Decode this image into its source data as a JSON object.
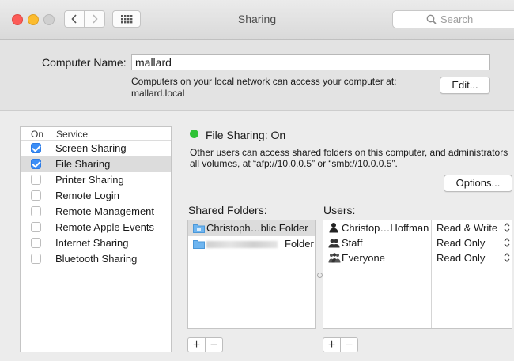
{
  "window": {
    "title": "Sharing",
    "search_placeholder": "Search"
  },
  "computer_name": {
    "label": "Computer Name:",
    "value": "mallard",
    "info_line1": "Computers on your local network can access your computer at:",
    "info_line2": "mallard.local",
    "edit_button": "Edit..."
  },
  "services": {
    "col_on": "On",
    "col_service": "Service",
    "items": [
      {
        "label": "Screen Sharing",
        "checked": true,
        "selected": false
      },
      {
        "label": "File Sharing",
        "checked": true,
        "selected": true
      },
      {
        "label": "Printer Sharing",
        "checked": false,
        "selected": false
      },
      {
        "label": "Remote Login",
        "checked": false,
        "selected": false
      },
      {
        "label": "Remote Management",
        "checked": false,
        "selected": false
      },
      {
        "label": "Remote Apple Events",
        "checked": false,
        "selected": false
      },
      {
        "label": "Internet Sharing",
        "checked": false,
        "selected": false
      },
      {
        "label": "Bluetooth Sharing",
        "checked": false,
        "selected": false
      }
    ]
  },
  "detail": {
    "status": "File Sharing: On",
    "status_color": "#2fc236",
    "description": "Other users can access shared folders on this computer, and administrators all volumes, at “afp://10.0.0.5” or “smb://10.0.0.5”.",
    "options_button": "Options...",
    "shared_folders_label": "Shared Folders:",
    "users_label": "Users:",
    "folders": [
      {
        "name": "Christoph…blic Folder",
        "selected": true
      },
      {
        "name": "Folder",
        "selected": false
      }
    ],
    "users": [
      {
        "name": "Christop…Hoffman",
        "permission": "Read & Write",
        "icon": "single-user-icon"
      },
      {
        "name": "Staff",
        "permission": "Read Only",
        "icon": "group-icon"
      },
      {
        "name": "Everyone",
        "permission": "Read Only",
        "icon": "everyone-icon"
      }
    ]
  },
  "controls": {
    "add": "+",
    "remove": "−"
  },
  "colors": {
    "accent": "#3c8ef6",
    "close": "#fc5b57",
    "minimize": "#fcbc2e"
  }
}
